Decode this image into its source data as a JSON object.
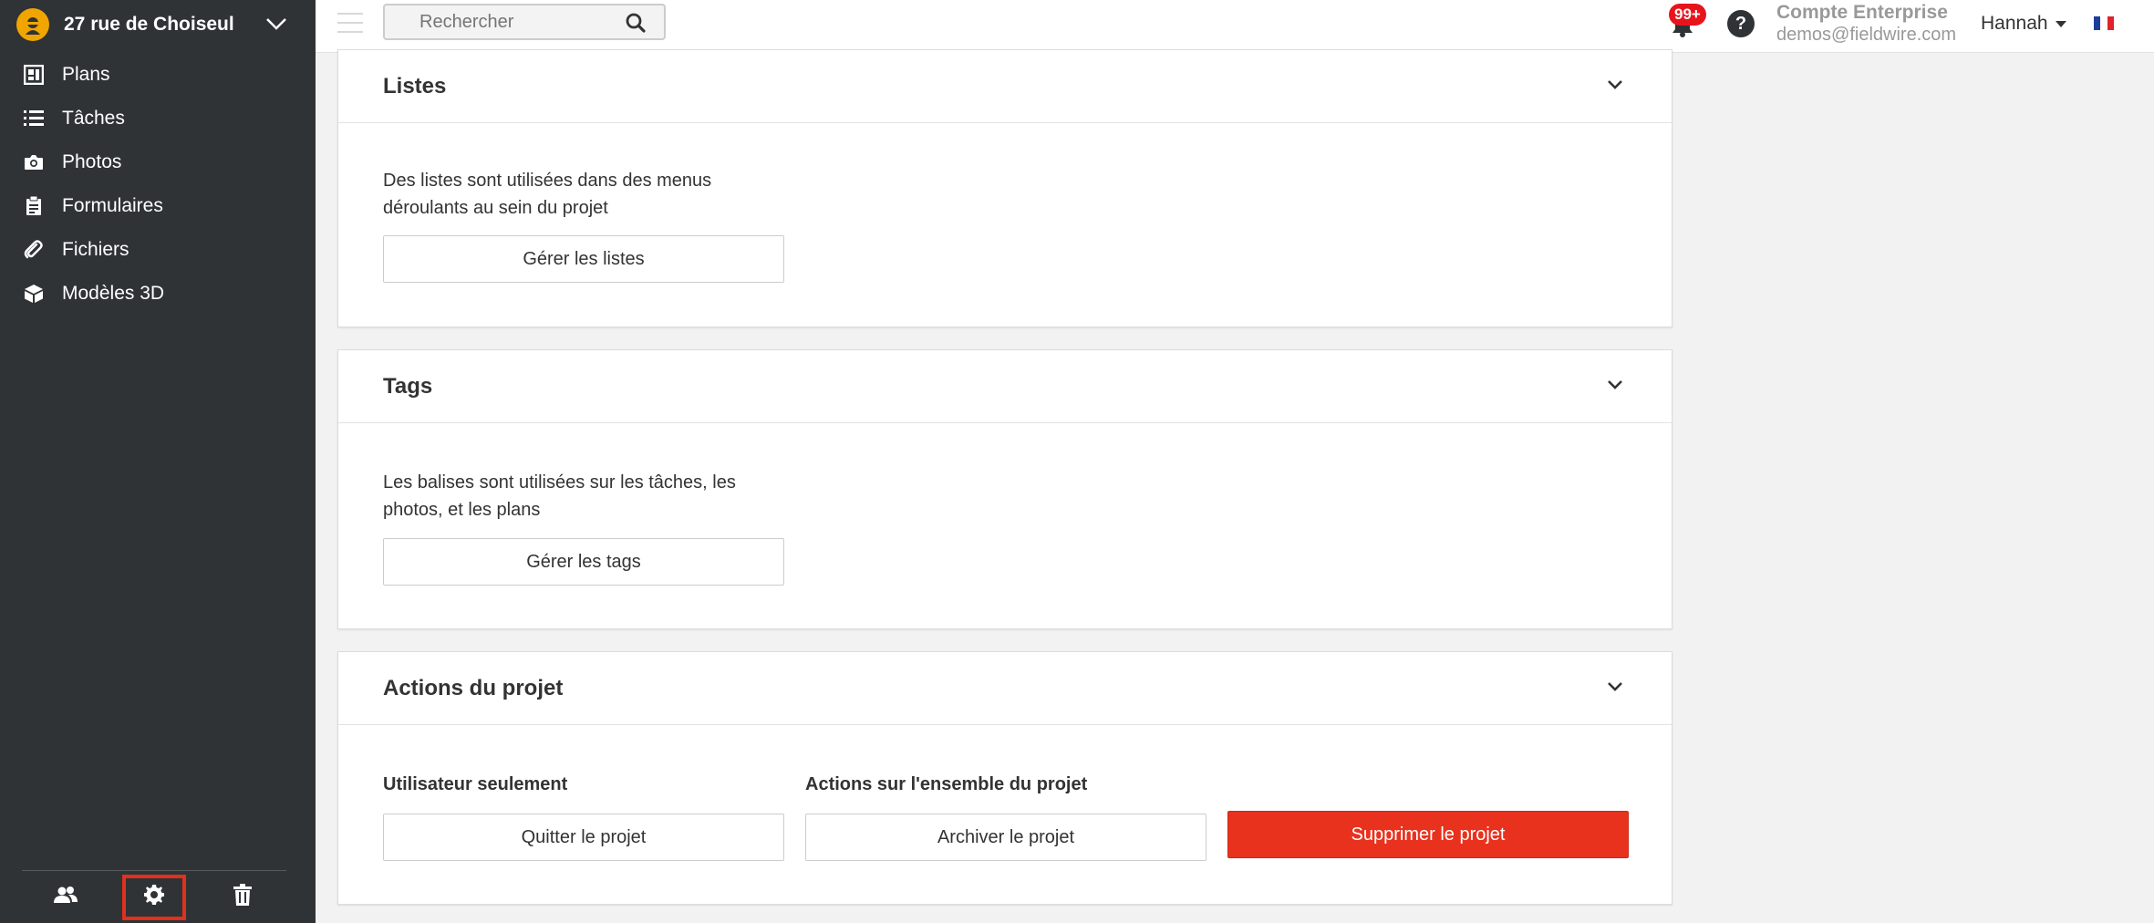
{
  "project": {
    "name": "27 rue de Choiseul"
  },
  "nav": [
    {
      "label": "Plans",
      "icon": "plans-icon"
    },
    {
      "label": "Tâches",
      "icon": "list-icon"
    },
    {
      "label": "Photos",
      "icon": "camera-icon"
    },
    {
      "label": "Formulaires",
      "icon": "clipboard-icon"
    },
    {
      "label": "Fichiers",
      "icon": "paperclip-icon"
    },
    {
      "label": "Modèles 3D",
      "icon": "cube-icon"
    }
  ],
  "topbar": {
    "search_placeholder": "Rechercher",
    "notifications_badge": "99+",
    "help": "?",
    "account_type": "Compte Enterprise",
    "account_email": "demos@fieldwire.com",
    "user_name": "Hannah"
  },
  "sections": {
    "lists": {
      "title": "Listes",
      "description": "Des listes sont utilisées dans des menus déroulants au sein du projet",
      "button": "Gérer les listes"
    },
    "tags": {
      "title": "Tags",
      "description": "Les balises sont utilisées sur les tâches, les photos, et les plans",
      "button": "Gérer les tags"
    },
    "actions": {
      "title": "Actions du projet",
      "user_only": "Utilisateur seulement",
      "project_wide": "Actions sur l'ensemble du projet",
      "leave": "Quitter le projet",
      "archive": "Archiver le projet",
      "delete": "Supprimer le projet"
    }
  },
  "colors": {
    "sidebar": "#2f3336",
    "danger": "#e8321e",
    "badge": "#e8141c",
    "logo": "#f0a500"
  }
}
